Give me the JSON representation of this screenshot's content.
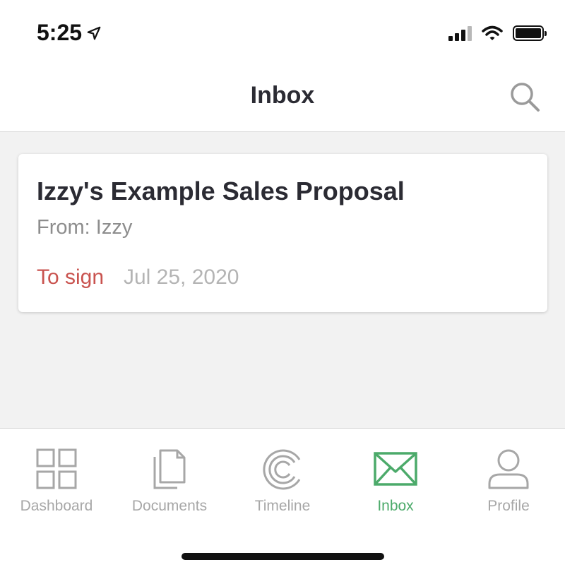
{
  "status_bar": {
    "time": "5:25"
  },
  "header": {
    "title": "Inbox"
  },
  "documents": [
    {
      "title": "Izzy's Example Sales Proposal",
      "from": "From: Izzy",
      "status": "To sign",
      "date": "Jul 25, 2020"
    }
  ],
  "tabs": [
    {
      "label": "Dashboard",
      "icon": "dashboard-icon",
      "active": false
    },
    {
      "label": "Documents",
      "icon": "documents-icon",
      "active": false
    },
    {
      "label": "Timeline",
      "icon": "timeline-icon",
      "active": false
    },
    {
      "label": "Inbox",
      "icon": "inbox-icon",
      "active": true
    },
    {
      "label": "Profile",
      "icon": "profile-icon",
      "active": false
    }
  ],
  "colors": {
    "accent_green": "#4caa6a",
    "status_red": "#c9534f",
    "inactive_gray": "#a7a7a7",
    "background": "#f2f2f2"
  }
}
